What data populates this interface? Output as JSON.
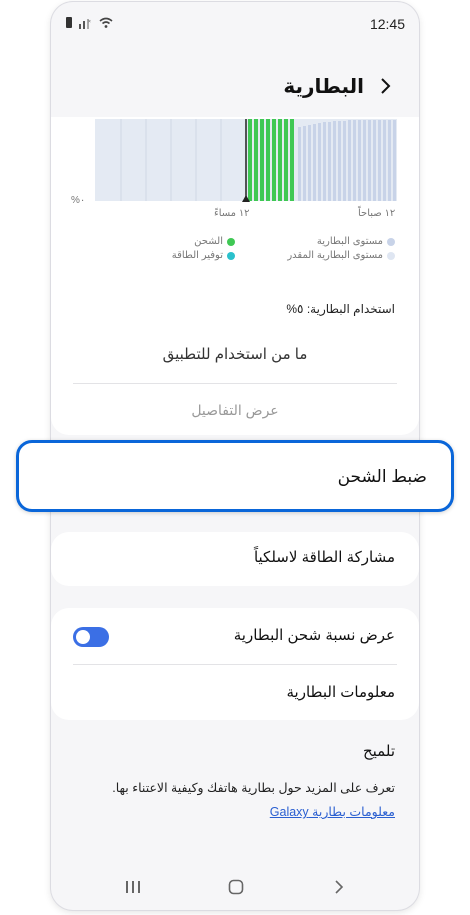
{
  "status": {
    "time": "12:45"
  },
  "header": {
    "title": "البطارية"
  },
  "chart": {
    "pct_label": "%٠",
    "x_left_label": "١٢ مساءً",
    "x_right_label": "١٢ صباحاً",
    "legend": {
      "battery_level": "مستوى البطارية",
      "estimated_level": "مستوى البطارية المقدر",
      "charging": "الشحن",
      "power_saving": "توفير الطاقة"
    },
    "colors": {
      "charging": "#3fc854",
      "power_saving": "#2bc1cc",
      "battery": "#c8d3e8",
      "estimated": "#dfe6f2"
    }
  },
  "usage": {
    "label": "استخدام البطارية: ٥%",
    "no_app_usage": "ما من استخدام للتطبيق",
    "view_details": "عرض التفاصيل"
  },
  "charging_settings": {
    "label": "ضبط الشحن"
  },
  "wireless_share": {
    "label": "مشاركة الطاقة لاسلكياً"
  },
  "show_percentage": {
    "label": "عرض نسبة شحن البطارية",
    "enabled": true
  },
  "battery_info": {
    "label": "معلومات البطارية"
  },
  "tip": {
    "title": "تلميح",
    "text": "تعرف على المزيد حول بطارية هاتفك وكيفية الاعتناء بها.",
    "link": "معلومات بطارية Galaxy"
  },
  "nav": {
    "recent_icon": "recent-apps-icon",
    "home_icon": "home-icon",
    "back_icon": "back-icon"
  }
}
